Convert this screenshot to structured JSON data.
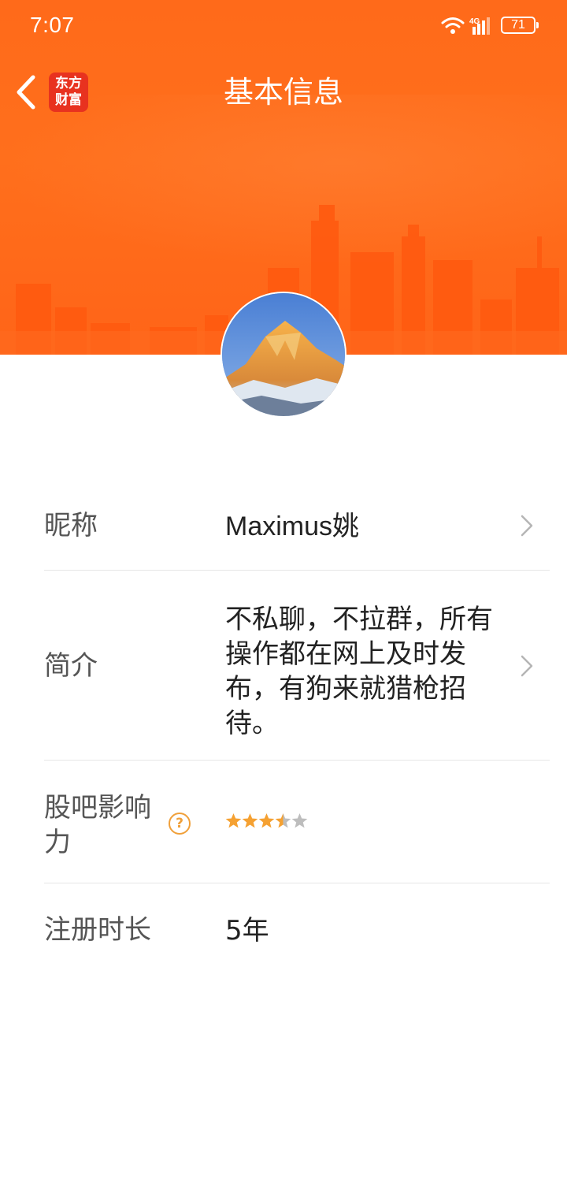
{
  "status_bar": {
    "time": "7:07",
    "network": "4G",
    "battery": "71"
  },
  "nav": {
    "logo_line1": "东方",
    "logo_line2": "财富",
    "title": "基本信息"
  },
  "profile": {
    "rows": {
      "nickname": {
        "label": "昵称",
        "value": "Maximus姚"
      },
      "bio": {
        "label": "简介",
        "value": "不私聊，不拉群，所有操作都在网上及时发布，有狗来就猎枪招待。"
      },
      "influence": {
        "label": "股吧影响力",
        "rating": 3.5,
        "rating_max": 5
      },
      "reg_time": {
        "label": "注册时长",
        "value": "5年"
      }
    }
  },
  "colors": {
    "header_orange": "#ff6a1a",
    "star_filled": "#f5a132",
    "star_empty": "#bdbdbd",
    "logo_red": "#e8321f"
  }
}
